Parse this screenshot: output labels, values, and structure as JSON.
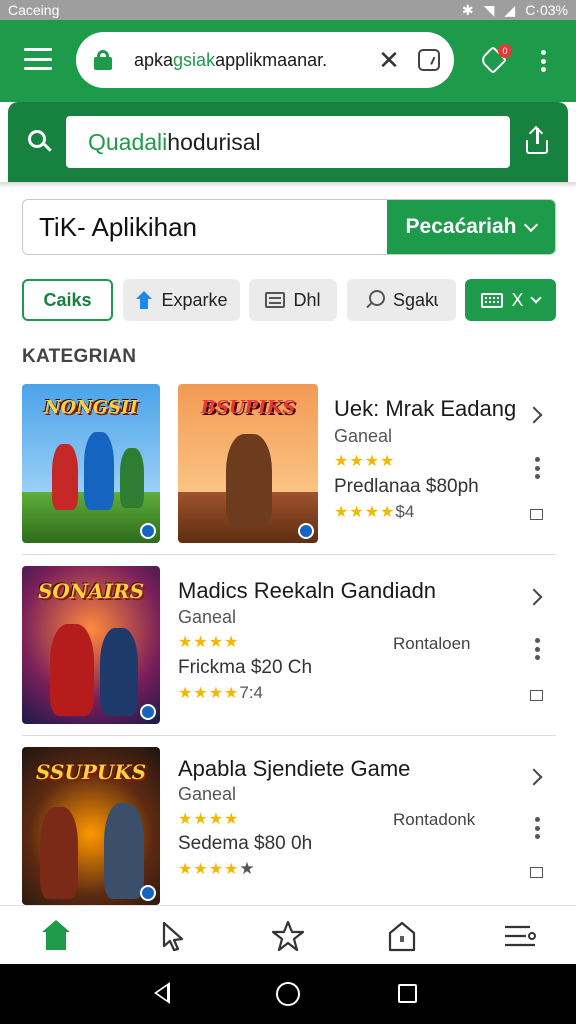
{
  "status_bar": {
    "carrier": "Caceing",
    "battery": "C·03%"
  },
  "toolbar": {
    "url_prefix": "apka",
    "url_highlight": "gsiak",
    "url_rest": "applikmaanar.",
    "close_glyph": "✕",
    "badge": "0"
  },
  "search": {
    "prefix": "Quadali",
    "rest": " hodurisal"
  },
  "filter": {
    "value": "TiK- Aplikihan",
    "button_label": "Pecaćariah"
  },
  "chips": [
    {
      "label": "Caiks"
    },
    {
      "label": "Exparke"
    },
    {
      "label": "Dhl"
    },
    {
      "label": "Sgakɩ"
    },
    {
      "label": "X"
    }
  ],
  "section_title": "KATEGRIAN",
  "items": [
    {
      "title": "Uek: Mrak Eadang",
      "category": "Ganeal",
      "rating_stars": "★★★★",
      "price": "Predlanaa $80ph",
      "stars_second": "★★★★",
      "stars_suffix": "$4",
      "thumb1_logo": "NONGSII",
      "thumb2_logo": "BSUPIKS"
    },
    {
      "title": "Madics Reekaln Gandiadn",
      "category": "Ganeal",
      "rating_stars": "★★★★",
      "label": "Rontaloen",
      "price": "Frickma $20 Ch",
      "stars_second": "★★★★",
      "stars_suffix": "7:4",
      "thumb_logo": "SONAIRS"
    },
    {
      "title": "Apabla Sjendiete Game",
      "category": "Ganeal",
      "rating_stars": "★★★★",
      "label": "Rontadonk",
      "price": "Sedema $80 0h",
      "stars_second": "★★★★",
      "stars_suffix": "★",
      "thumb_logo": "SSUPUKS"
    }
  ],
  "colors": {
    "primary": "#1e9a4b",
    "primary_dark": "#17823f",
    "star": "#f5b800"
  }
}
